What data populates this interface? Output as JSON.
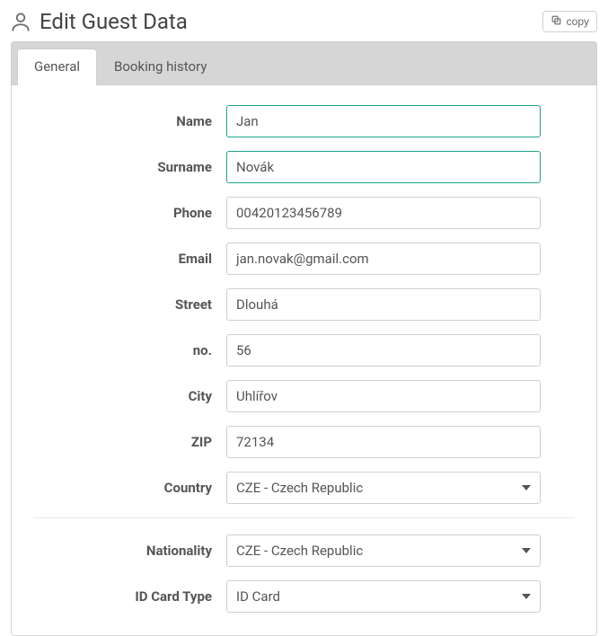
{
  "header": {
    "title": "Edit Guest Data",
    "copy_label": "copy"
  },
  "tabs": {
    "general": "General",
    "history": "Booking history"
  },
  "labels": {
    "name": "Name",
    "surname": "Surname",
    "phone": "Phone",
    "email": "Email",
    "street": "Street",
    "no": "no.",
    "city": "City",
    "zip": "ZIP",
    "country": "Country",
    "nationality": "Nationality",
    "id_card_type": "ID Card Type"
  },
  "values": {
    "name": "Jan",
    "surname": "Novák",
    "phone": "00420123456789",
    "email": "jan.novak@gmail.com",
    "street": "Dlouhá",
    "no": "56",
    "city": "Uhlířov",
    "zip": "72134",
    "country": "CZE - Czech Republic",
    "nationality": "CZE - Czech Republic",
    "id_card_type": "ID Card"
  }
}
